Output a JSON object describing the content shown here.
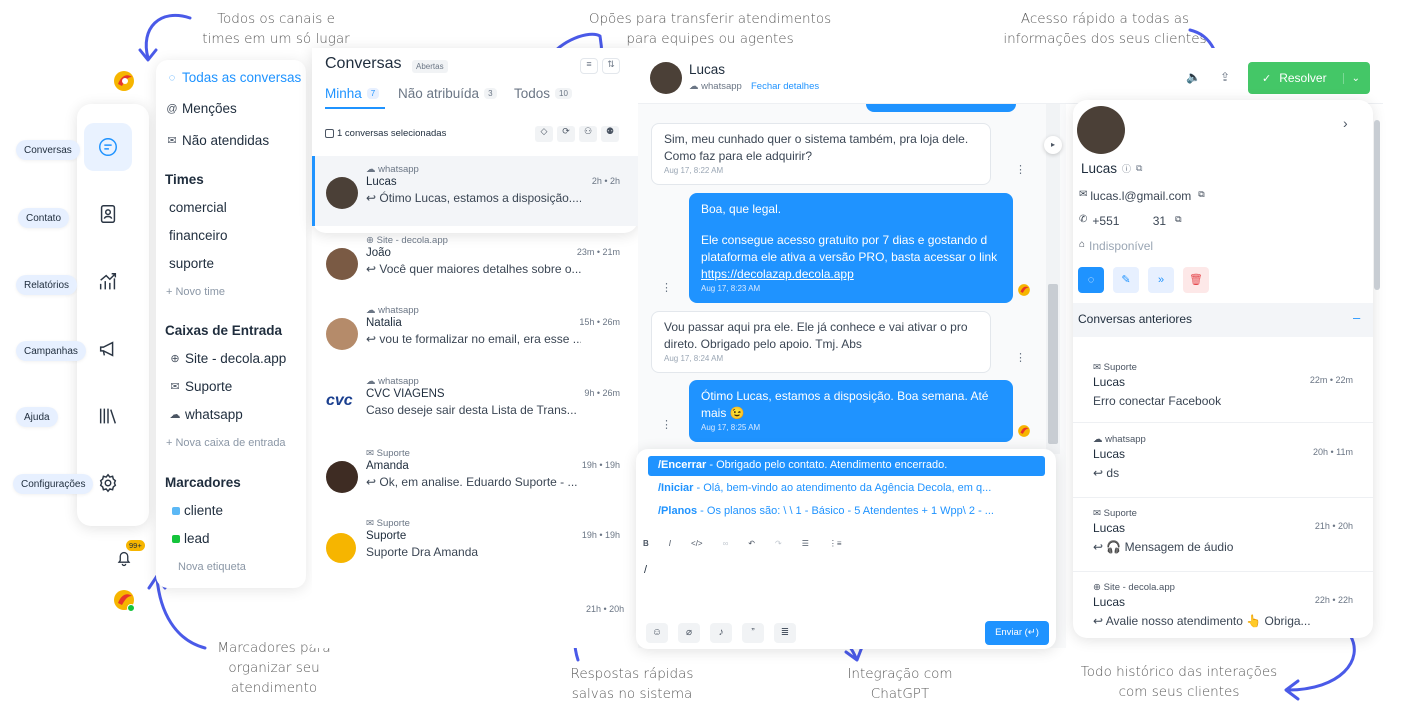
{
  "annotations": {
    "canais": [
      "Todos os canais e",
      "times em um só lugar"
    ],
    "transferir": [
      "Opões para transferir atendimentos",
      "para equipes ou agentes"
    ],
    "acesso": [
      "Acesso rápido a todas as",
      "informações dos seus clientes"
    ],
    "marcadores": [
      "Marcadores para",
      "organizar seu",
      "atendimento"
    ],
    "respostas": [
      "Respostas rápidas",
      "salvas no sistema"
    ],
    "chatgpt": [
      "Integração com",
      "ChatGPT"
    ],
    "historico": [
      "Todo histórico das interações",
      "com seus clientes"
    ]
  },
  "nav": {
    "items": [
      {
        "label": "Conversas",
        "icon": "chat-icon"
      },
      {
        "label": "Contato",
        "icon": "contact-card-icon"
      },
      {
        "label": "Relatórios",
        "icon": "chart-icon"
      },
      {
        "label": "Campanhas",
        "icon": "megaphone-icon"
      },
      {
        "label": "Ajuda",
        "icon": "library-icon"
      },
      {
        "label": "Configurações",
        "icon": "gear-icon"
      }
    ],
    "notification_badge": "99+"
  },
  "sidebar": {
    "all": "Todas as conversas",
    "mentions": "Menções",
    "unattended": "Não atendidas",
    "teams_title": "Times",
    "teams": [
      "comercial",
      "financeiro",
      "suporte"
    ],
    "new_team": "+ Novo time",
    "inboxes_title": "Caixas de Entrada",
    "inboxes": [
      "Site - decola.app",
      "Suporte",
      "whatsapp"
    ],
    "new_inbox": "+ Nova caixa de entrada",
    "labels_title": "Marcadores",
    "labels": [
      {
        "name": "cliente",
        "color": "#5bb8f5"
      },
      {
        "name": "lead",
        "color": "#14c43b"
      }
    ],
    "new_label": "Nova etiqueta"
  },
  "conversations": {
    "title": "Conversas",
    "status": "Abertas",
    "tabs": [
      {
        "label": "Minha",
        "count": "7"
      },
      {
        "label": "Não atribuída",
        "count": "3"
      },
      {
        "label": "Todos",
        "count": "10"
      }
    ],
    "selected_text": "1 conversas selecionadas",
    "items": [
      {
        "source": "whatsapp",
        "name": "Lucas",
        "message": "↩ Ótimo Lucas, estamos a disposição....",
        "time": "2h • 2h"
      },
      {
        "source": "Site - decola.app",
        "name": "João",
        "message": "↩ Você quer maiores detalhes sobre o...",
        "time": "23m • 21m"
      },
      {
        "source": "whatsapp",
        "name": "Natalia",
        "message": "↩ vou te formalizar no email, era esse ...",
        "time": "15h • 26m"
      },
      {
        "source": "whatsapp",
        "name": "CVC VIAGENS",
        "message": "Caso deseje sair desta Lista de Trans...",
        "time": "9h • 26m"
      },
      {
        "source": "Suporte",
        "name": "Amanda",
        "message": "↩ Ok, em analise. Eduardo Suporte - ...",
        "time": "19h • 19h"
      },
      {
        "source": "Suporte",
        "name": "Suporte",
        "message": "Suporte Dra Amanda",
        "time": "19h • 19h"
      }
    ],
    "last_time": "21h • 20h"
  },
  "chat": {
    "contact_name": "Lucas",
    "channel": "whatsapp",
    "close_details": "Fechar detalhes",
    "resolve": "Resolver",
    "messages": [
      {
        "dir": "in",
        "lines": [
          "Sim, meu cunhado quer o sistema também, pra loja dele.",
          "Como faz para ele adquirir?"
        ],
        "time": "Aug 17, 8:22 AM"
      },
      {
        "dir": "out",
        "lines": [
          "Boa, que legal.",
          "",
          "Ele consegue acesso gratuito por 7 dias e gostando d",
          "plataforma ele ativa a versão PRO, basta acessar o link"
        ],
        "link": "https://decolazap.decola.app",
        "time": "Aug 17, 8:23 AM"
      },
      {
        "dir": "in",
        "lines": [
          "Vou passar aqui pra ele. Ele já conhece e vai ativar o pro",
          "direto. Obrigado pelo apoio. Tmj. Abs"
        ],
        "time": "Aug 17, 8:24 AM"
      },
      {
        "dir": "out",
        "lines": [
          "Ótimo Lucas, estamos a disposição. Boa semana. Até",
          "mais 😉"
        ],
        "time": "Aug 17, 8:25 AM"
      }
    ],
    "quick_replies": [
      {
        "cmd": "/Encerrar",
        "text": " - Obrigado pelo contato. Atendimento encerrado."
      },
      {
        "cmd": "/Iniciar",
        "text": " - Olá, bem-vindo ao atendimento da Agência Decola, em q..."
      },
      {
        "cmd": "/Planos",
        "text": " - Os planos são: \\ \\ 1 - Básico - 5 Atendentes + 1 Wpp\\ 2 - ..."
      }
    ],
    "editor_value": "/",
    "send": "Enviar (↵)"
  },
  "contact": {
    "name": "Lucas",
    "email": "lucas.l@gmail.com",
    "phone": "+551          31",
    "company": "Indisponível",
    "previous_title": "Conversas anteriores",
    "previous": [
      {
        "source": "Suporte",
        "name": "Lucas",
        "message": "Erro conectar Facebook",
        "time": "22m • 22m"
      },
      {
        "source": "whatsapp",
        "name": "Lucas",
        "message": "↩ ds",
        "time": "20h • 11m"
      },
      {
        "source": "Suporte",
        "name": "Lucas",
        "message": "↩ 🎧 Mensagem de áudio",
        "time": "21h • 20h"
      },
      {
        "source": "Site - decola.app",
        "name": "Lucas",
        "message": "↩ Avalie nosso atendimento 👆 Obriga...",
        "time": "22h • 22h"
      }
    ]
  }
}
